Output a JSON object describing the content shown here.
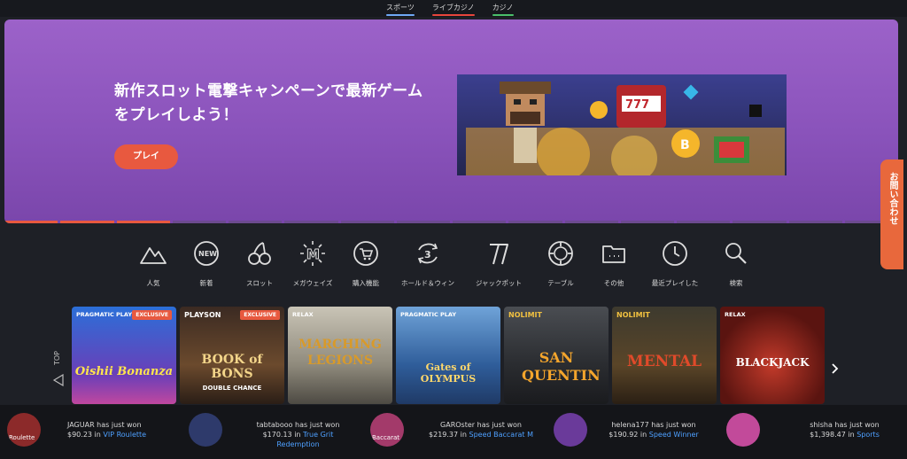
{
  "tabs": [
    {
      "label": "スポーツ",
      "color": "#6fa9f5"
    },
    {
      "label": "ライブカジノ",
      "color": "#e8453c"
    },
    {
      "label": "カジノ",
      "color": "#4bbf6b"
    }
  ],
  "banner": {
    "title": "新作スロット電撃キャンペーンで最新ゲームをプレイしよう！",
    "play_label": "プレイ"
  },
  "side_tab": {
    "label": "お問い合わせ"
  },
  "categories": [
    {
      "label": "人気",
      "icon": "mountain-icon"
    },
    {
      "label": "新着",
      "icon": "new-badge-icon"
    },
    {
      "label": "スロット",
      "icon": "cherry-icon"
    },
    {
      "label": "メガウェイズ",
      "icon": "megaways-icon"
    },
    {
      "label": "購入機能",
      "icon": "cart-icon"
    },
    {
      "label": "ホールド＆ウィン",
      "icon": "hold-win-icon"
    },
    {
      "label": "ジャックポット",
      "icon": "seven-icon"
    },
    {
      "label": "テーブル",
      "icon": "chip-icon"
    },
    {
      "label": "その他",
      "icon": "folder-icon"
    },
    {
      "label": "最近プレイした",
      "icon": "clock-icon"
    },
    {
      "label": "検索",
      "icon": "search-icon"
    }
  ],
  "games": [
    {
      "provider": "PRAGMATIC PLAY",
      "badge": "EXCLUSIVE",
      "title": "Oishii Bonanza"
    },
    {
      "provider": "PLAYSON",
      "badge": "EXCLUSIVE",
      "title": "BOOK of BONS",
      "subtitle": "DOUBLE CHANCE"
    },
    {
      "provider": "RELAX",
      "badge": "",
      "title": "MARCHING LEGIONS"
    },
    {
      "provider": "PRAGMATIC PLAY",
      "badge": "",
      "title": "Gates of OLYMPUS"
    },
    {
      "provider": "NOLIMIT",
      "badge": "",
      "title": "SAN QUENTIN"
    },
    {
      "provider": "NOLIMIT",
      "badge": "",
      "title": "MENTAL"
    },
    {
      "provider": "RELAX",
      "badge": "",
      "title": "BLACKJACK"
    }
  ],
  "top_label": "TOP",
  "winners": [
    {
      "avatar_label": "Roulette",
      "line1": "JAGUAR has just won",
      "amount": "$90.23 in",
      "game": "VIP Roulette"
    },
    {
      "avatar_label": "",
      "line1": "tabtabooo has just won",
      "amount": "$170.13 in",
      "game": "True Grit Redemption"
    },
    {
      "avatar_label": "Baccarat",
      "line1": "GAROster has just won",
      "amount": "$219.37 in",
      "game": "Speed Baccarat M"
    },
    {
      "avatar_label": "",
      "line1": "helena177 has just won",
      "amount": "$190.92 in",
      "game": "Speed Winner"
    },
    {
      "avatar_label": "",
      "line1": "shisha has just won",
      "amount": "$1,398.47 in",
      "game": "Sports"
    }
  ]
}
